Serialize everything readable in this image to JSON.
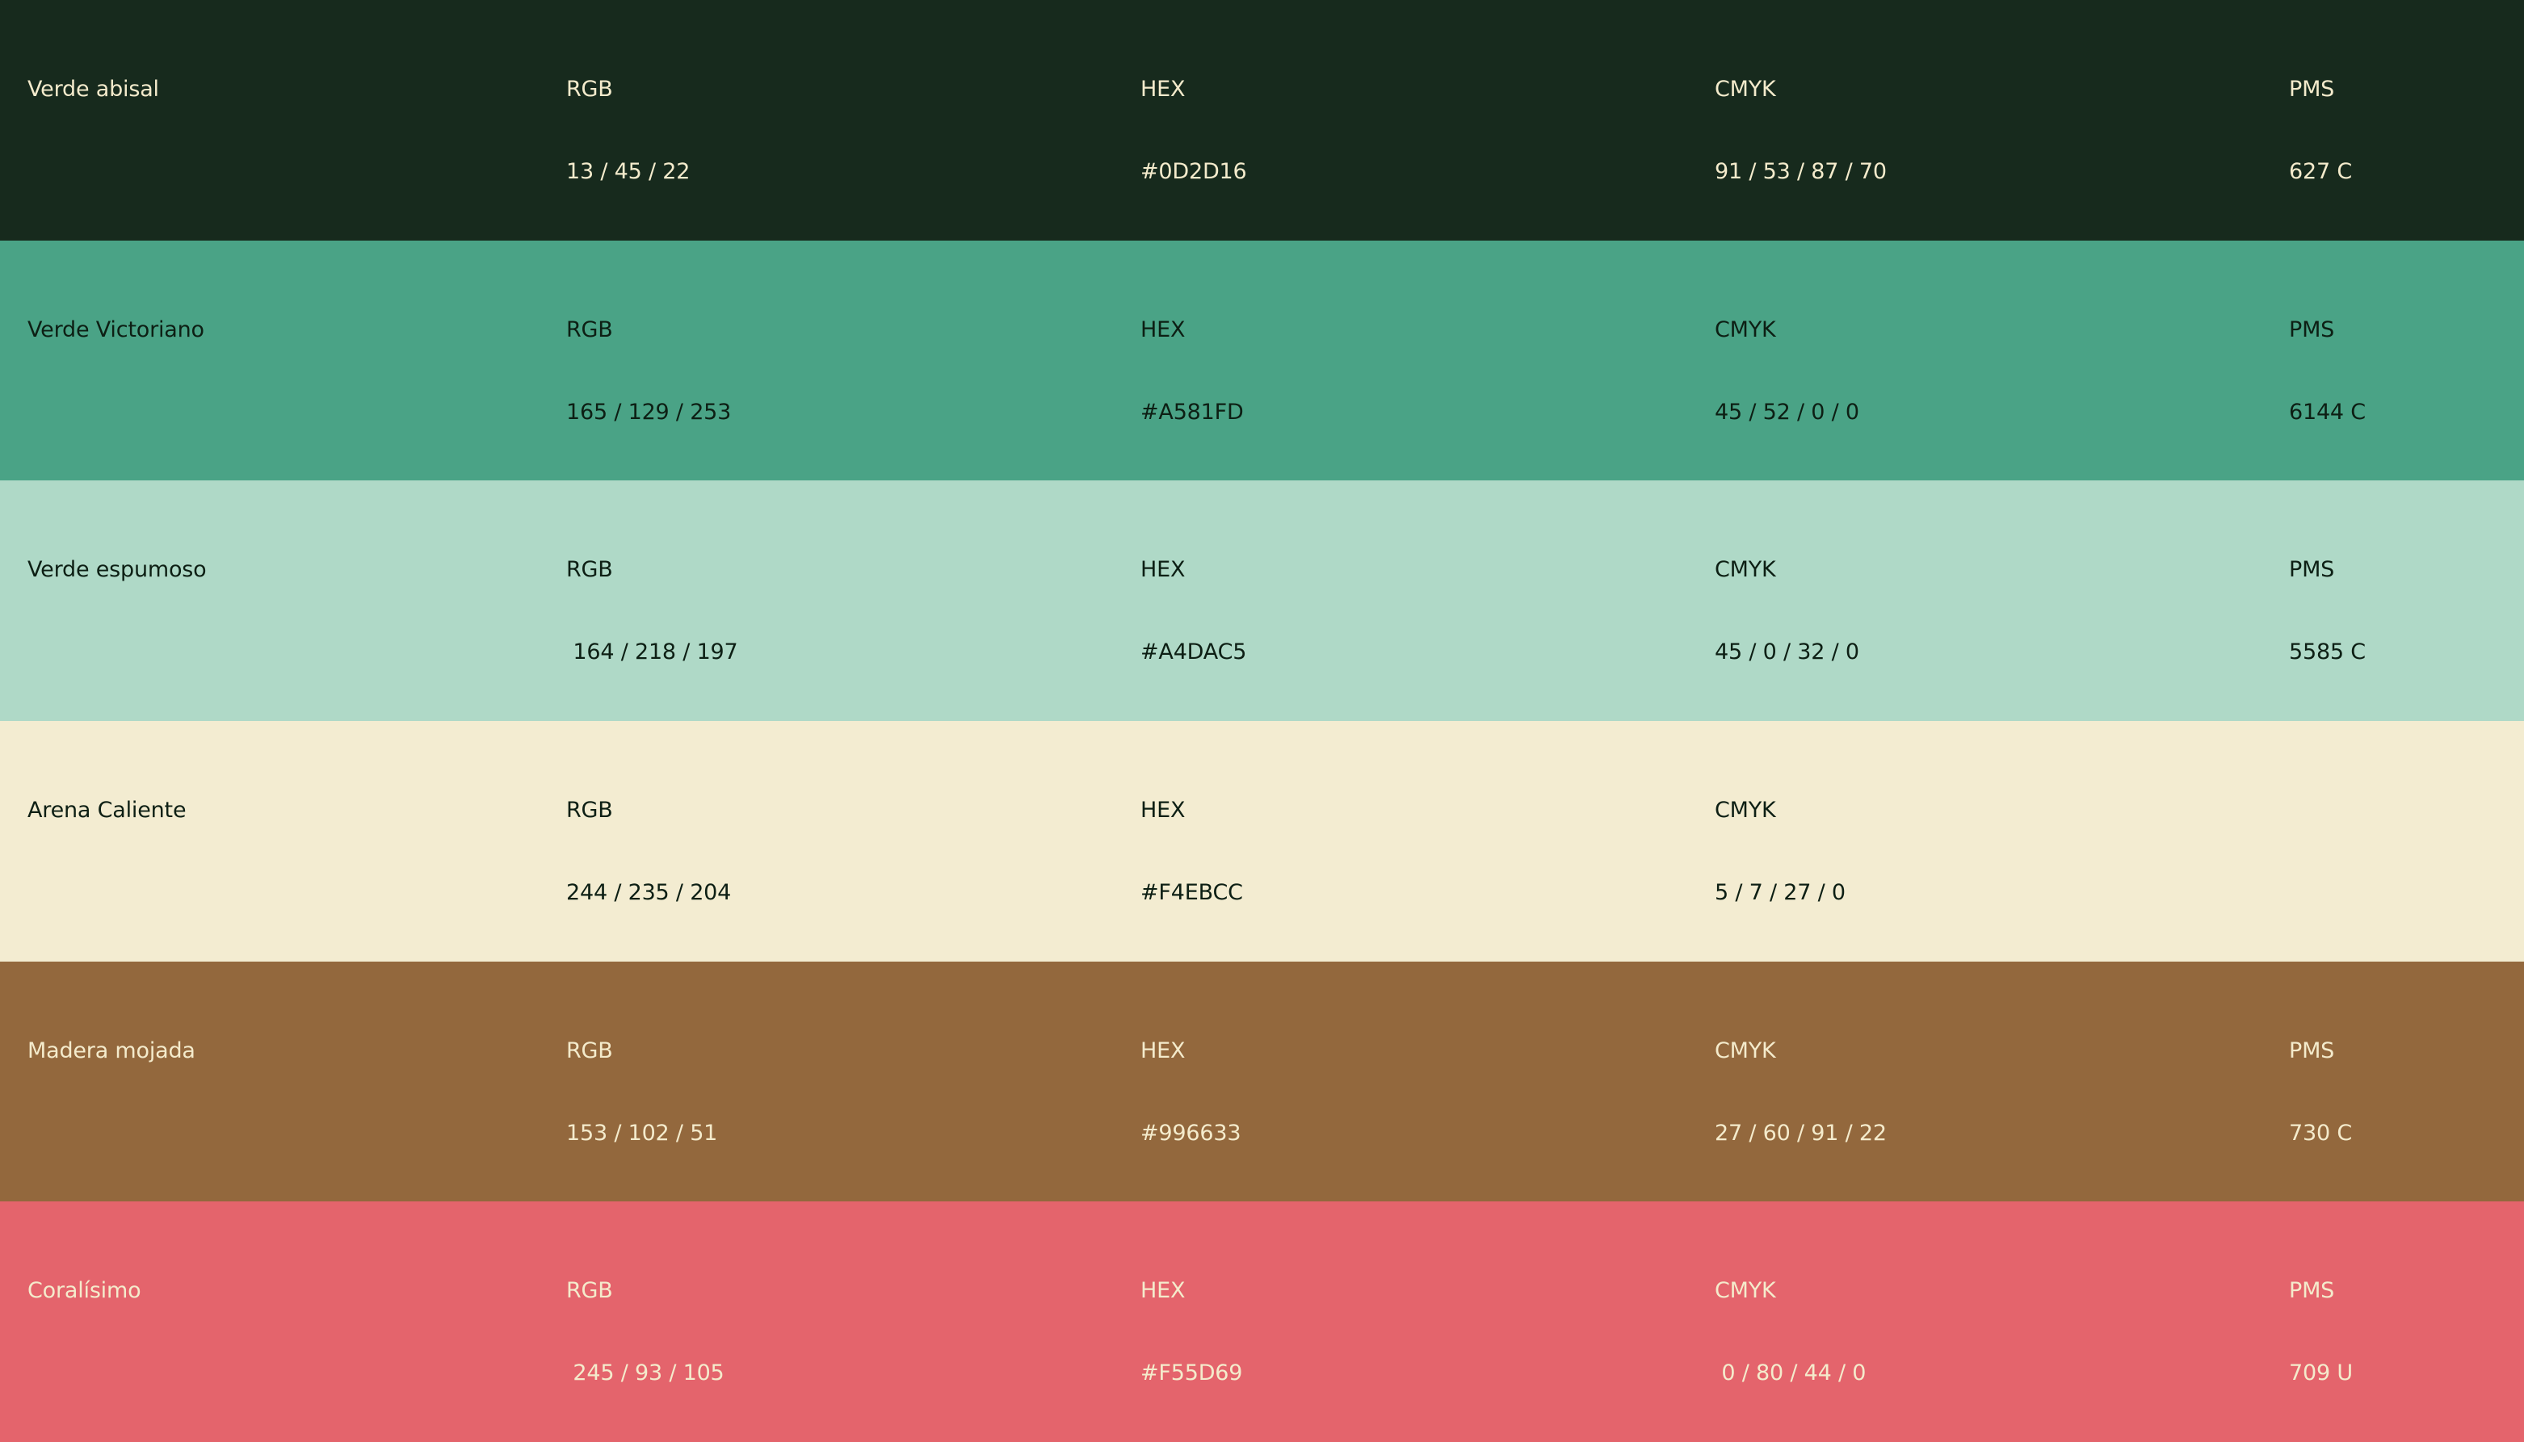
{
  "labels": {
    "rgb": "RGB",
    "hex": "HEX",
    "cmyk": "CMYK",
    "pms": "PMS"
  },
  "colors": [
    {
      "name": "Verde abisal",
      "rgb": "13 / 45 / 22",
      "hex": "#0D2D16",
      "cmyk": "91 / 53 / 87 / 70",
      "pms": "627 C",
      "background": "#172a1d",
      "text_color": "#f4ebcc"
    },
    {
      "name": "Verde Victoriano",
      "rgb": "165 / 129 / 253",
      "hex": "#A581FD",
      "cmyk": "45 / 52 / 0 / 0",
      "pms": "6144 C",
      "background": "#4aa386",
      "text_color": "#0d1f14"
    },
    {
      "name": "Verde espumoso",
      "rgb": " 164 / 218 / 197",
      "hex": "#A4DAC5",
      "cmyk": "45 / 0 / 32 / 0",
      "pms": "5585 C",
      "background": "#afd9c7",
      "text_color": "#0d1f14"
    },
    {
      "name": "Arena Caliente",
      "rgb": "244 / 235 / 204",
      "hex": "#F4EBCC",
      "cmyk": "5 / 7 / 27 / 0",
      "pms": "",
      "background": "#f3ecd1",
      "text_color": "#0d1f14"
    },
    {
      "name": "Madera mojada",
      "rgb": "153 / 102 / 51",
      "hex": "#996633",
      "cmyk": "27 / 60 / 91 / 22",
      "pms": "730 C",
      "background": "#93683d",
      "text_color": "#f4ebcc"
    },
    {
      "name": "Coralísimo",
      "rgb": " 245 / 93 / 105",
      "hex": "#F55D69",
      "cmyk": " 0 / 80 / 44 / 0",
      "pms": "709 U",
      "background": "#e4646c",
      "text_color": "#f4ebcc"
    }
  ]
}
